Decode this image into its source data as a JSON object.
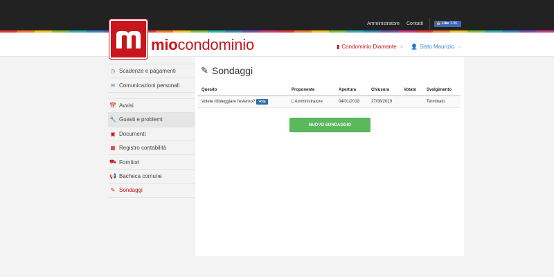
{
  "top_nav": {
    "links": [
      "Amministratore",
      "Contatti"
    ],
    "fb_like": {
      "label": "Like",
      "count": "3.9K"
    }
  },
  "colors": {
    "brand_red": "#c8161d",
    "link_blue": "#3a87c8",
    "button_green": "#5cb85c",
    "stripe": [
      "#e33b3b",
      "#f07b2c",
      "#f5c328",
      "#7fbf3f",
      "#2fb2a8",
      "#3a87c8",
      "#7a52b3",
      "#d03c8a"
    ]
  },
  "header": {
    "brand_prefix": "mio",
    "brand_suffix": "condominio",
    "condo_label": "Condominio Diamante",
    "user_label": "Sisto Maurizio"
  },
  "sidebar": {
    "group1": [
      {
        "label": "Scadenze e pagamenti",
        "icon": "clock-icon"
      },
      {
        "label": "Comunicazioni personali",
        "icon": "envelope-icon"
      }
    ],
    "group2": [
      {
        "label": "Avvisi",
        "icon": "calendar-icon"
      },
      {
        "label": "Guasti e problemi",
        "icon": "wrench-icon"
      },
      {
        "label": "Documenti",
        "icon": "archive-icon"
      },
      {
        "label": "Registro contabilità",
        "icon": "calculator-icon"
      },
      {
        "label": "Fornitori",
        "icon": "truck-icon"
      },
      {
        "label": "Bacheca comune",
        "icon": "bullhorn-icon"
      },
      {
        "label": "Sondaggi",
        "icon": "edit-icon"
      }
    ]
  },
  "main": {
    "title": "Sondaggi",
    "table": {
      "headers": [
        "Quesito",
        "Proponente",
        "Apertura",
        "Chiusura",
        "Votato",
        "Svolgimento"
      ],
      "rows": [
        {
          "quesito": "Volete ritinteggiare l'esterno?",
          "vota": "Vota",
          "proponente": "L'Amministratore",
          "apertura": "04/01/2018",
          "chiusura": "27/08/2019",
          "votato": "",
          "svolgimento": "Terminato"
        }
      ]
    },
    "new_button": "NUOVO SONDAGGIO"
  }
}
